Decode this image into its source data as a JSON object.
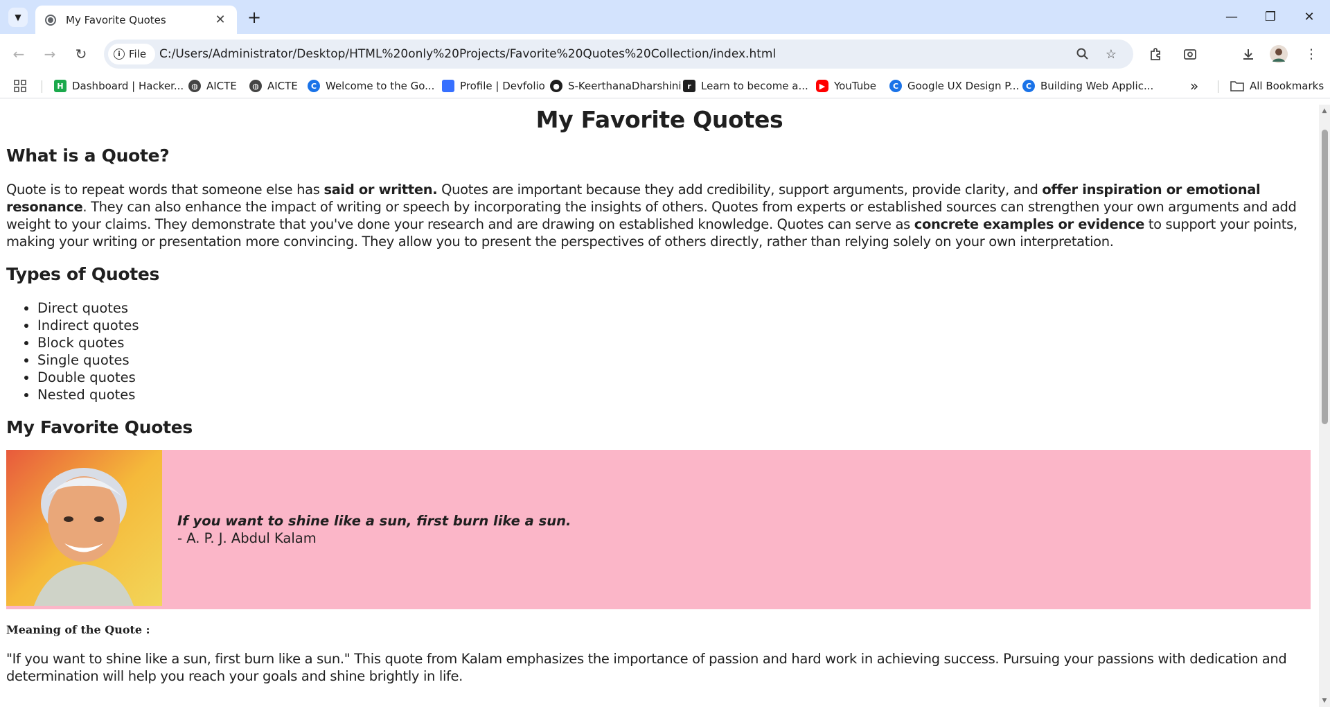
{
  "browser": {
    "tab_title": "My Favorite Quotes",
    "new_tab": "+",
    "site_chip": "File",
    "url": "C:/Users/Administrator/Desktop/HTML%20only%20Projects/Favorite%20Quotes%20Collection/index.html",
    "bookmarks": [
      "Dashboard | Hacker...",
      "AICTE",
      "AICTE",
      "Welcome to the Go...",
      "Profile | Devfolio",
      "S-KeerthanaDharshini",
      "Learn to become a...",
      "YouTube",
      "Google UX Design P...",
      "Building Web Applic..."
    ],
    "all_bookmarks": "All Bookmarks",
    "overflow": "»"
  },
  "page": {
    "title": "My Favorite Quotes",
    "what_heading": "What is a Quote?",
    "what_p": {
      "t1": "Quote is to repeat words that someone else has ",
      "b1": "said or written.",
      "t2": " Quotes are important because they add credibility, support arguments, provide clarity, and ",
      "b2": "offer inspiration or emotional resonance",
      "t3": ". They can also enhance the impact of writing or speech by incorporating the insights of others. Quotes from experts or established sources can strengthen your own arguments and add weight to your claims. They demonstrate that you've done your research and are drawing on established knowledge. Quotes can serve as ",
      "b3": "concrete examples or evidence",
      "t4": " to support your points, making your writing or presentation more convincing. They allow you to present the perspectives of others directly, rather than relying solely on your own interpretation."
    },
    "types_heading": "Types of Quotes",
    "types": [
      "Direct quotes",
      "Indirect quotes",
      "Block quotes",
      "Single quotes",
      "Double quotes",
      "Nested quotes"
    ],
    "fav_heading": "My Favorite Quotes",
    "quote": {
      "text": "If you want to shine like a sun, first burn like a sun.",
      "author": "- A. P. J. Abdul Kalam",
      "bg_color": "#fbb6c8"
    },
    "meaning_title": "Meaning of the Quote :",
    "meaning_text": "\"If you want to shine like a sun, first burn like a sun.\" This quote from Kalam emphasizes the importance of passion and hard work in achieving success. Pursuing your passions with dedication and determination will help you reach your goals and shine brightly in life."
  }
}
